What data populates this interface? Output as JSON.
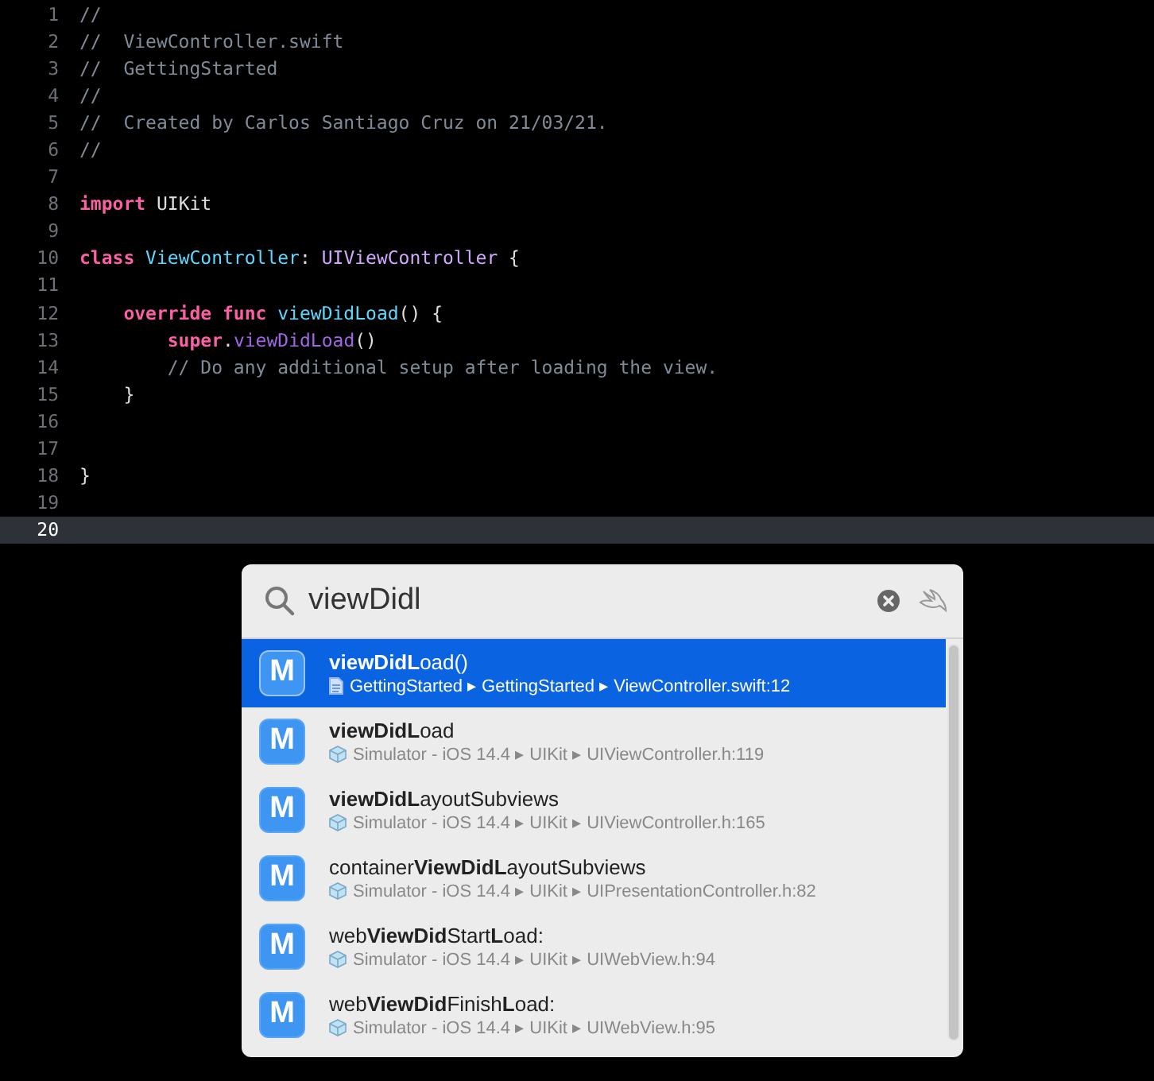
{
  "editor": {
    "lines": [
      {
        "number": "1",
        "current": false,
        "tokens": [
          {
            "kind": "comment",
            "text": "//"
          }
        ]
      },
      {
        "number": "2",
        "current": false,
        "tokens": [
          {
            "kind": "comment",
            "text": "//  ViewController.swift"
          }
        ]
      },
      {
        "number": "3",
        "current": false,
        "tokens": [
          {
            "kind": "comment",
            "text": "//  GettingStarted"
          }
        ]
      },
      {
        "number": "4",
        "current": false,
        "tokens": [
          {
            "kind": "comment",
            "text": "//"
          }
        ]
      },
      {
        "number": "5",
        "current": false,
        "tokens": [
          {
            "kind": "comment",
            "text": "//  Created by Carlos Santiago Cruz on 21/03/21."
          }
        ]
      },
      {
        "number": "6",
        "current": false,
        "tokens": [
          {
            "kind": "comment",
            "text": "//"
          }
        ]
      },
      {
        "number": "7",
        "current": false
      },
      {
        "number": "8",
        "current": false,
        "tokens": [
          {
            "kind": "keyword",
            "text": "import"
          },
          {
            "kind": "plain",
            "text": " UIKit"
          }
        ]
      },
      {
        "number": "9",
        "current": false
      },
      {
        "number": "10",
        "current": false,
        "tokens": [
          {
            "kind": "keyword",
            "text": "class"
          },
          {
            "kind": "declaration",
            "text": " ViewController"
          },
          {
            "kind": "plain",
            "text": ": "
          },
          {
            "kind": "type",
            "text": "UIViewController"
          },
          {
            "kind": "plain",
            "text": " {"
          }
        ]
      },
      {
        "number": "11",
        "current": false
      },
      {
        "number": "12",
        "current": false,
        "tokens": [
          {
            "kind": "keyword",
            "text": "    override func"
          },
          {
            "kind": "declaration",
            "text": " viewDidLoad"
          },
          {
            "kind": "plain",
            "text": "() {"
          }
        ]
      },
      {
        "number": "13",
        "current": false,
        "tokens": [
          {
            "kind": "keyword",
            "text": "        super"
          },
          {
            "kind": "plain",
            "text": "."
          },
          {
            "kind": "call",
            "text": "viewDidLoad"
          },
          {
            "kind": "plain",
            "text": "()"
          }
        ]
      },
      {
        "number": "14",
        "current": false,
        "tokens": [
          {
            "kind": "comment",
            "text": "        // Do any additional setup after loading the view."
          }
        ]
      },
      {
        "number": "15",
        "current": false,
        "tokens": [
          {
            "kind": "plain",
            "text": "    }"
          }
        ]
      },
      {
        "number": "16",
        "current": false
      },
      {
        "number": "17",
        "current": false
      },
      {
        "number": "18",
        "current": false,
        "tokens": [
          {
            "kind": "plain",
            "text": "}"
          }
        ]
      },
      {
        "number": "19",
        "current": false
      },
      {
        "number": "20",
        "current": true
      }
    ]
  },
  "quick_open": {
    "search": {
      "value": "viewDidl"
    },
    "results": [
      {
        "badge": "M",
        "title": "**viewDidL**oad()",
        "kind": "file",
        "location": "GettingStarted ▸ GettingStarted ▸ ViewController.swift:12",
        "selected": true
      },
      {
        "badge": "M",
        "title": "**viewDidL**oad",
        "kind": "sdk",
        "location": "Simulator - iOS 14.4 ▸ UIKit ▸ UIViewController.h:119",
        "selected": false
      },
      {
        "badge": "M",
        "title": "**viewDidL**ayoutSubviews",
        "kind": "sdk",
        "location": "Simulator - iOS 14.4 ▸ UIKit ▸ UIViewController.h:165",
        "selected": false
      },
      {
        "badge": "M",
        "title": "container**ViewDidL**ayoutSubviews",
        "kind": "sdk",
        "location": "Simulator - iOS 14.4 ▸ UIKit ▸ UIPresentationController.h:82",
        "selected": false
      },
      {
        "badge": "M",
        "title": "web**ViewDid**Start**L**oad:",
        "kind": "sdk",
        "location": "Simulator - iOS 14.4 ▸ UIKit ▸ UIWebView.h:94",
        "selected": false
      },
      {
        "badge": "M",
        "title": "web**ViewDid**Finish**L**oad:",
        "kind": "sdk",
        "location": "Simulator - iOS 14.4 ▸ UIKit ▸ UIWebView.h:95",
        "selected": false
      }
    ]
  }
}
